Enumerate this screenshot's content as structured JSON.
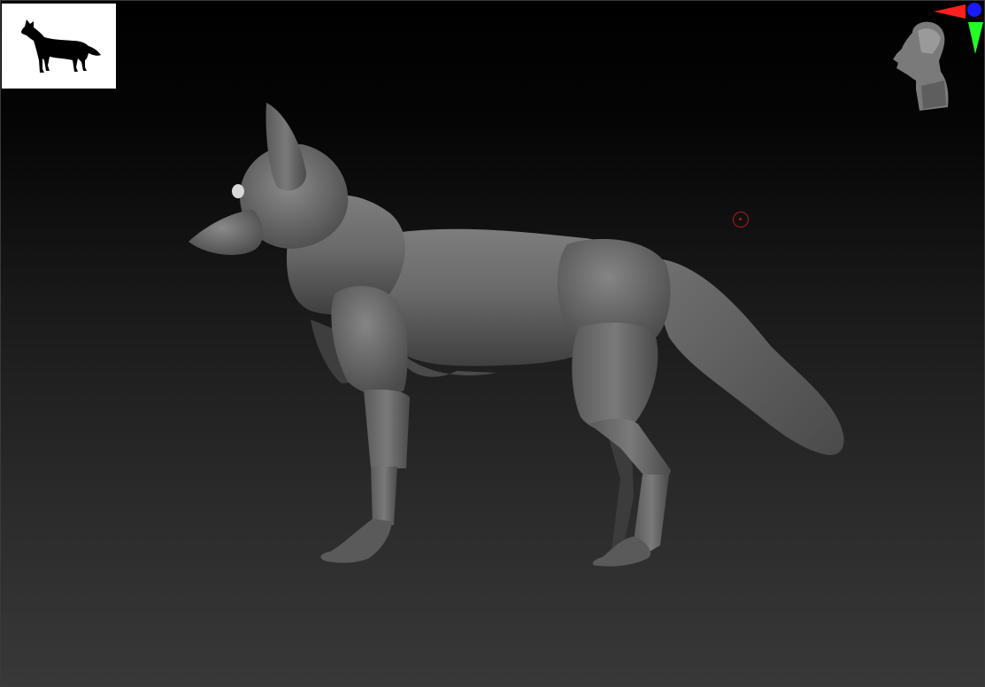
{
  "window": {
    "app": "ZBrush",
    "view": "perspective-viewport"
  },
  "reference_image": {
    "subject": "fox-silhouette",
    "background_color": "#ffffff",
    "silhouette_color": "#000000"
  },
  "navigation_gizmo": {
    "icon": "head-orientation-icon",
    "axis_colors": {
      "x": "#ff1f1f",
      "y": "#22ff22",
      "z": "#1a1aff"
    }
  },
  "model": {
    "subject": "fox-base-mesh",
    "material_color": "#8a8a8a"
  },
  "cursor": {
    "icon": "brush-cursor-icon",
    "color": "#b51a1a"
  },
  "colors": {
    "viewport_top": "#000000",
    "viewport_bottom": "#383838"
  }
}
